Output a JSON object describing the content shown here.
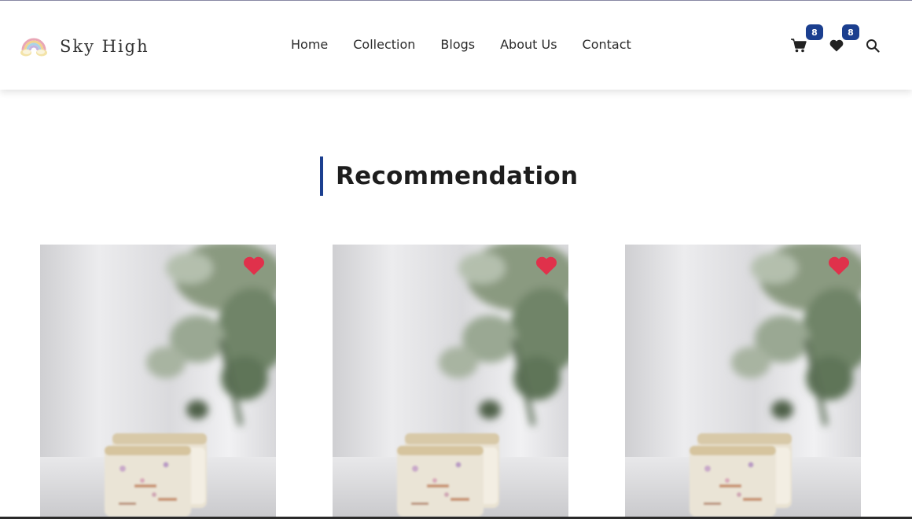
{
  "brand": {
    "name": "Sky High",
    "logo_icon": "rainbow-cloud-icon"
  },
  "nav": {
    "items": [
      "Home",
      "Collection",
      "Blogs",
      "About Us",
      "Contact"
    ]
  },
  "actions": {
    "cart": {
      "icon": "cart-icon",
      "count": "8"
    },
    "wishlist": {
      "icon": "heart-icon",
      "count": "8"
    },
    "search": {
      "icon": "search-icon"
    }
  },
  "colors": {
    "accent": "#1b3f8f",
    "favorite": "#e0314b"
  },
  "section": {
    "title": "Recommendation"
  },
  "products": [
    {
      "image_icon": "soap-bar-photo",
      "favorite": true,
      "favorite_icon": "heart-icon"
    },
    {
      "image_icon": "soap-bar-photo",
      "favorite": true,
      "favorite_icon": "heart-icon"
    },
    {
      "image_icon": "soap-bar-photo",
      "favorite": true,
      "favorite_icon": "heart-icon"
    }
  ]
}
